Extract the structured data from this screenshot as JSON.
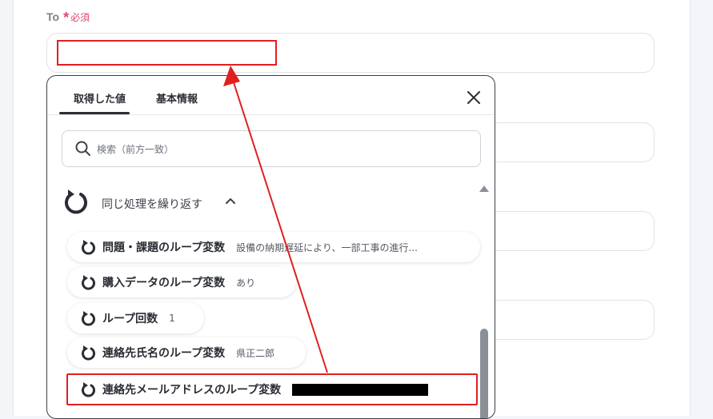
{
  "form": {
    "to_label": "To",
    "required_star": "*",
    "required_text": "必須"
  },
  "panel": {
    "tabs": [
      "取得した値",
      "基本情報"
    ],
    "search_placeholder": "検索（前方一致）",
    "group_title": "同じ処理を繰り返す",
    "items": [
      {
        "name": "問題・課題のループ変数",
        "value": "設備の納期遅延により、一部工事の進行..."
      },
      {
        "name": "購入データのループ変数",
        "value": "あり"
      },
      {
        "name": "ループ回数",
        "value": "1"
      },
      {
        "name": "連絡先氏名のループ変数",
        "value": "県正二郎"
      },
      {
        "name": "連絡先メールアドレスのループ変数",
        "value": ""
      }
    ]
  },
  "colors": {
    "required": "#e0456d",
    "highlight": "#e02020",
    "text_dark": "#2a2d33"
  },
  "icons": [
    "close-icon",
    "search-icon",
    "loop-icon",
    "chevron-up-icon"
  ]
}
